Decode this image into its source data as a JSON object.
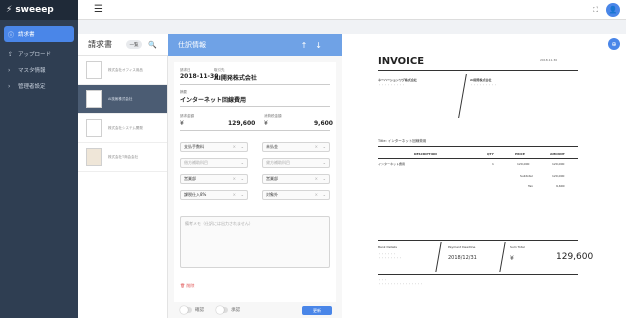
{
  "app": {
    "logo": "sweeep"
  },
  "sidebar": {
    "items": [
      {
        "icon": "document-icon",
        "label": "請求書"
      },
      {
        "icon": "upload-icon",
        "label": "アップロード"
      },
      {
        "icon": "database-icon",
        "label": "マスタ情報"
      },
      {
        "icon": "gear-icon",
        "label": "管理者設定"
      }
    ]
  },
  "doclist": {
    "title": "請求書",
    "list_btn": "一覧",
    "rows": [
      {
        "name": "株式会社オフィス用品"
      },
      {
        "name": "AI技術株式会社"
      },
      {
        "name": "株式会社システム開発"
      },
      {
        "name": "株式会社T商会会社"
      }
    ]
  },
  "form": {
    "header": "仕訳情報",
    "date_label": "請求日",
    "date_value": "2018-11-30",
    "partner_label": "取引先",
    "partner_value": "AI開発株式会社",
    "summary_label": "摘要",
    "summary_value": "インターネット回線費用",
    "amount_label": "請求金額",
    "amount_currency": "¥",
    "amount_value": "129,600",
    "tax_label": "消費税金額",
    "tax_currency": "¥",
    "tax_value": "9,600",
    "selects": [
      {
        "value": "支払手数料",
        "placeholder": false
      },
      {
        "value": "未払金",
        "placeholder": false
      },
      {
        "value": "借方補助科目",
        "placeholder": true
      },
      {
        "value": "貸方補助科目",
        "placeholder": true
      },
      {
        "value": "営業部",
        "placeholder": false
      },
      {
        "value": "営業部",
        "placeholder": false
      },
      {
        "value": "課税仕入8%",
        "placeholder": false
      },
      {
        "value": "対象外",
        "placeholder": false
      }
    ],
    "memo_placeholder": "備考メモ（仕訳には出力されません）",
    "delete_label": "削除",
    "toggle_confirm": "確認",
    "toggle_approve": "承認",
    "update_btn": "更新"
  },
  "invoice": {
    "title": "INVOICE",
    "date": "2018.11.30",
    "to_company": "ネーハーションワグ株式会社",
    "from_company": "AI開発株式会社",
    "subject": "Title: インターネット回線費用",
    "col_desc": "DESCRIPTION",
    "col_qty": "QTY",
    "col_price": "PRICE",
    "col_amount": "AMOUNT",
    "row_desc": "インターネット費用",
    "row_qty": "1",
    "row_price": "120,000",
    "row_amount": "120,000",
    "subtotal_label": "Subtotal",
    "subtotal_value": "120,000",
    "tax_label": "Tax",
    "tax_value": "9,600",
    "bank_label": "Bank Details",
    "due_label": "Payment Deadline",
    "due_value": "2018/12/31",
    "total_label": "Sum Total",
    "total_currency": "¥",
    "total_value": "129,600"
  }
}
